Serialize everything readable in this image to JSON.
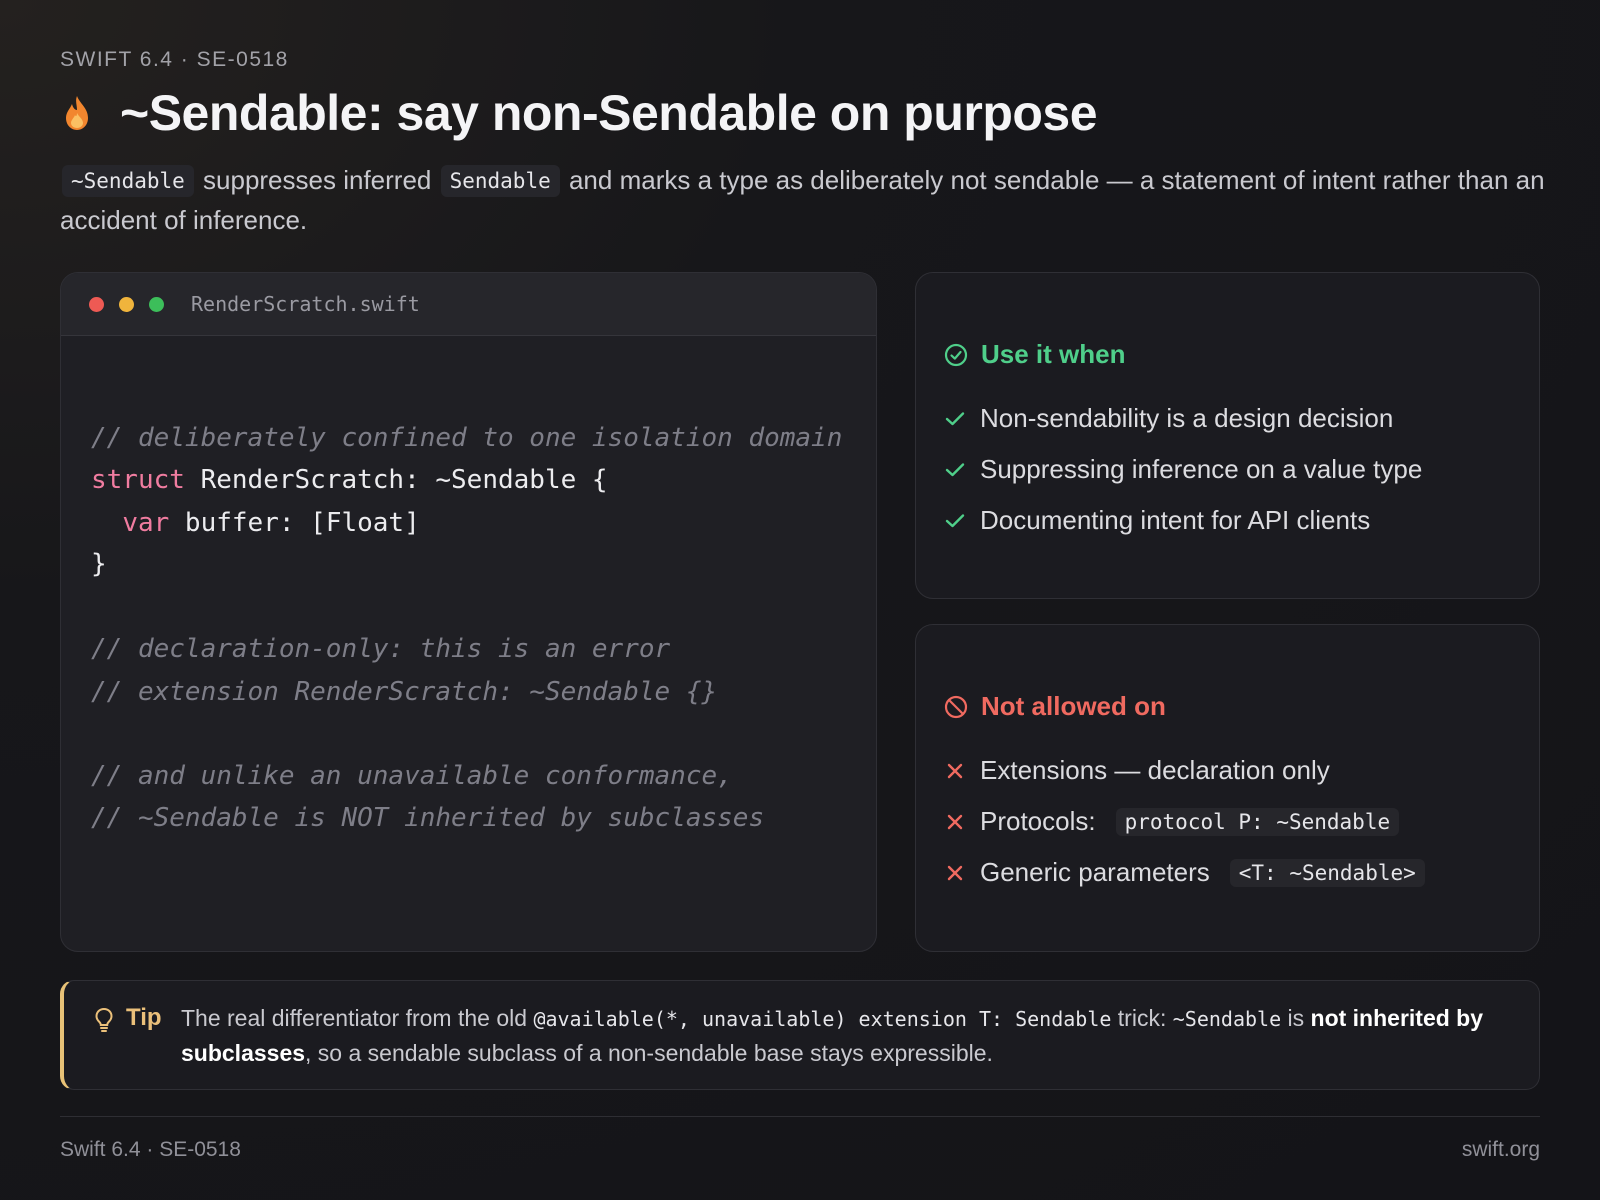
{
  "header": {
    "eyebrow": "SWIFT 6.4 · SE-0518",
    "title": "~Sendable: say non-Sendable on purpose",
    "title_icon": "flame-icon"
  },
  "lede": {
    "chip1": "~Sendable",
    "text1": " suppresses inferred ",
    "chip2": "Sendable",
    "text2": " and marks a type as deliberately not sendable — a statement of intent rather than an accident of inference."
  },
  "code": {
    "filename": "RenderScratch.swift",
    "comment1": "// deliberately confined to one isolation domain",
    "l2_kw": "struct",
    "l2_rest": " RenderScratch: ~Sendable {",
    "l3_indent": "  ",
    "l3_kw": "var",
    "l3_rest": " buffer: [Float]",
    "l4": "}",
    "comment2": "// declaration-only: this is an error",
    "comment3": "// extension RenderScratch: ~Sendable {}",
    "comment4": "// and unlike an unavailable conformance,",
    "comment5": "// ~Sendable is NOT inherited by subclasses"
  },
  "use_card": {
    "heading": "Use it when",
    "items": [
      "Non-sendability is a design decision",
      "Suppressing inference on a value type",
      "Documenting intent for API clients"
    ],
    "accent": "#4fcf8a"
  },
  "not_card": {
    "heading": "Not allowed on",
    "items": [
      {
        "text": "Extensions — declaration only",
        "code": ""
      },
      {
        "text": "Protocols:",
        "code": "protocol P: ~Sendable"
      },
      {
        "text": "Generic parameters",
        "code": "<T: ~Sendable>"
      }
    ],
    "accent": "#f06a60"
  },
  "tip": {
    "label": "Tip",
    "t1": "The real differentiator from the old ",
    "c1": "@available(*, unavailable) extension T: Sendable",
    "t2": " trick: ",
    "c2": "~Sendable",
    "t3": " is ",
    "b1": "not inherited by subclasses",
    "t4": ", so a sendable subclass of a non-sendable base stays expressible.",
    "accent": "#e8c277"
  },
  "footer": {
    "left": "Swift 6.4 · SE-0518",
    "right": "swift.org"
  }
}
